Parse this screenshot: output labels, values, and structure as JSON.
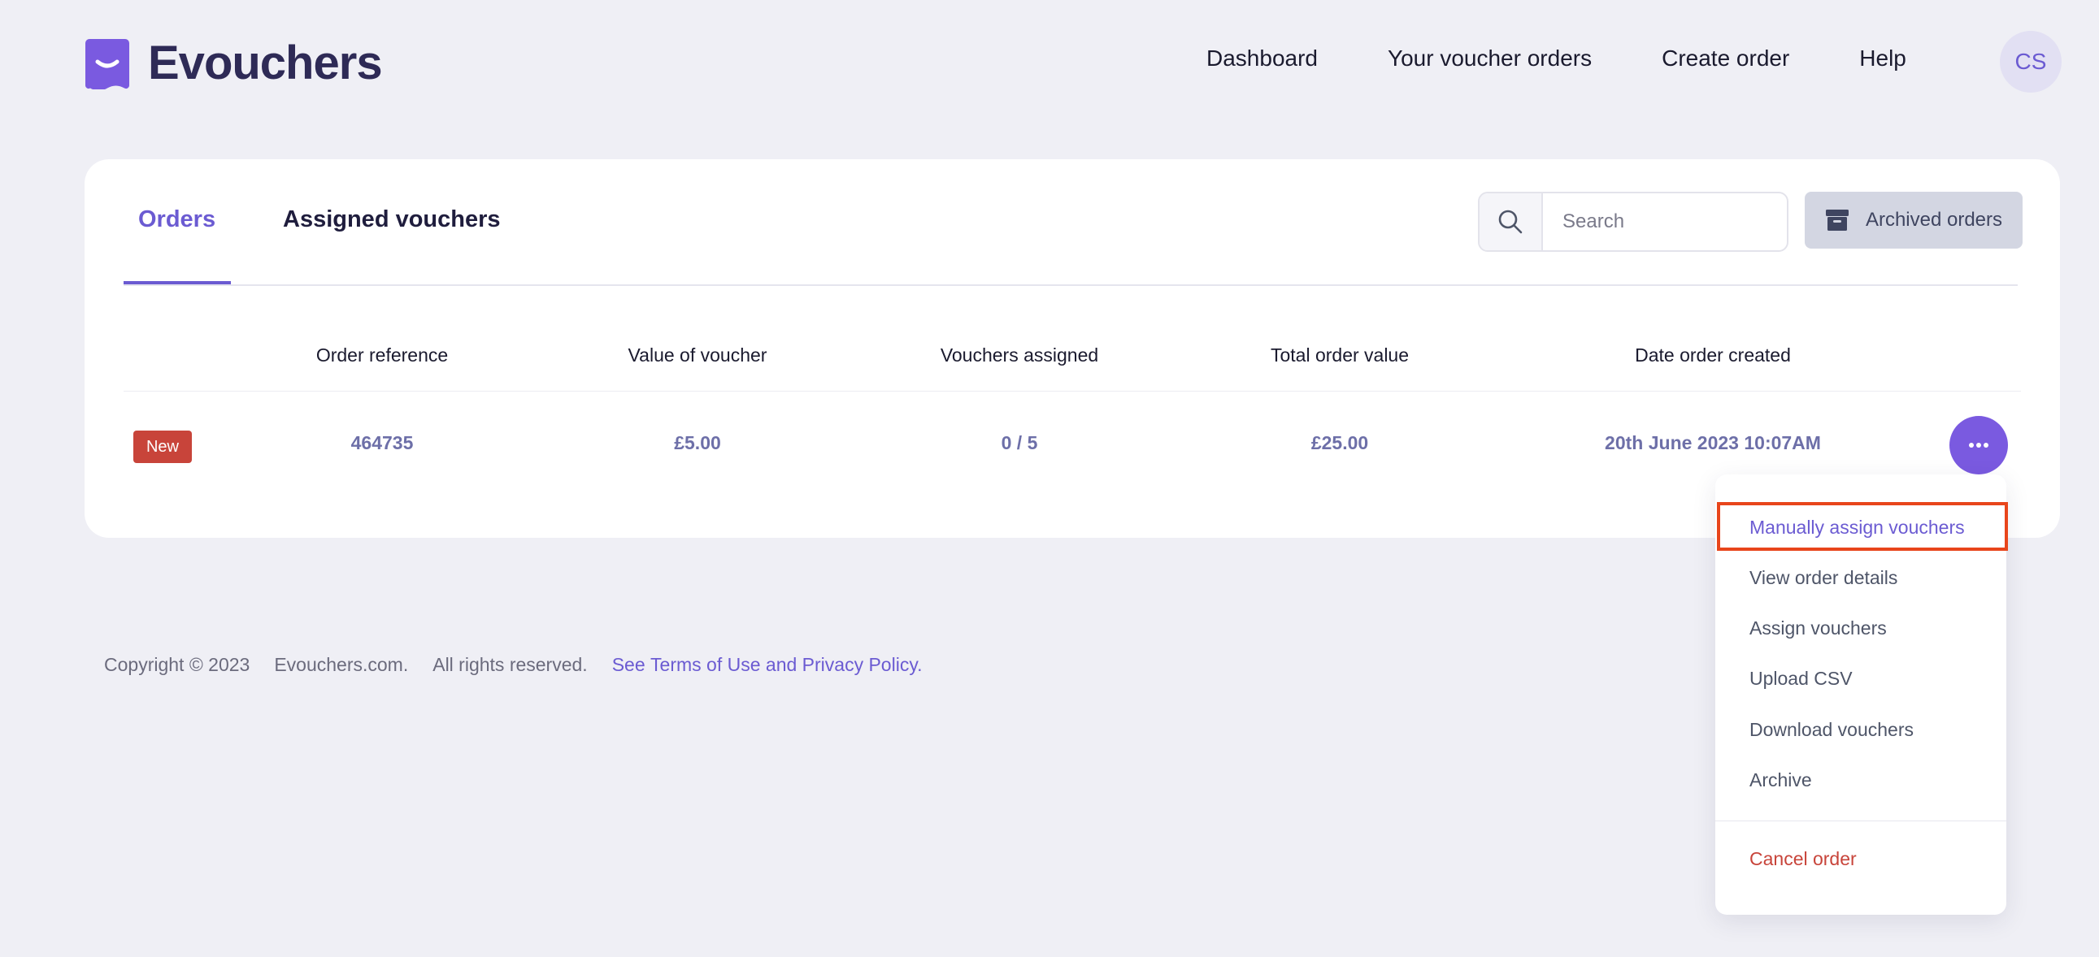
{
  "brand": {
    "name": "Evouchers",
    "accent": "#6b5bd2"
  },
  "nav": {
    "items": [
      "Dashboard",
      "Your voucher orders",
      "Create order",
      "Help"
    ],
    "avatar_initials": "CS"
  },
  "tabs": [
    {
      "label": "Orders",
      "active": true
    },
    {
      "label": "Assigned vouchers",
      "active": false
    }
  ],
  "search": {
    "placeholder": "Search",
    "value": ""
  },
  "archived_button": "Archived orders",
  "table": {
    "headers": [
      "Order reference",
      "Value of voucher",
      "Vouchers assigned",
      "Total order value",
      "Date order created"
    ],
    "rows": [
      {
        "badge": "New",
        "order_reference": "464735",
        "value_of_voucher": "£5.00",
        "vouchers_assigned": "0 / 5",
        "total_order_value": "£25.00",
        "date_order_created": "20th June 2023 10:07AM"
      }
    ]
  },
  "menu": {
    "items": [
      "Manually assign vouchers",
      "View order details",
      "Assign vouchers",
      "Upload CSV",
      "Download vouchers",
      "Archive"
    ],
    "danger_item": "Cancel order",
    "highlighted": "Manually assign vouchers"
  },
  "footer": {
    "copyright": "Copyright © 2023",
    "site": "Evouchers.com.",
    "rights": "All rights reserved.",
    "see": "See",
    "terms": "Terms of Use",
    "and": "and",
    "privacy": "Privacy Policy",
    "period": "."
  }
}
